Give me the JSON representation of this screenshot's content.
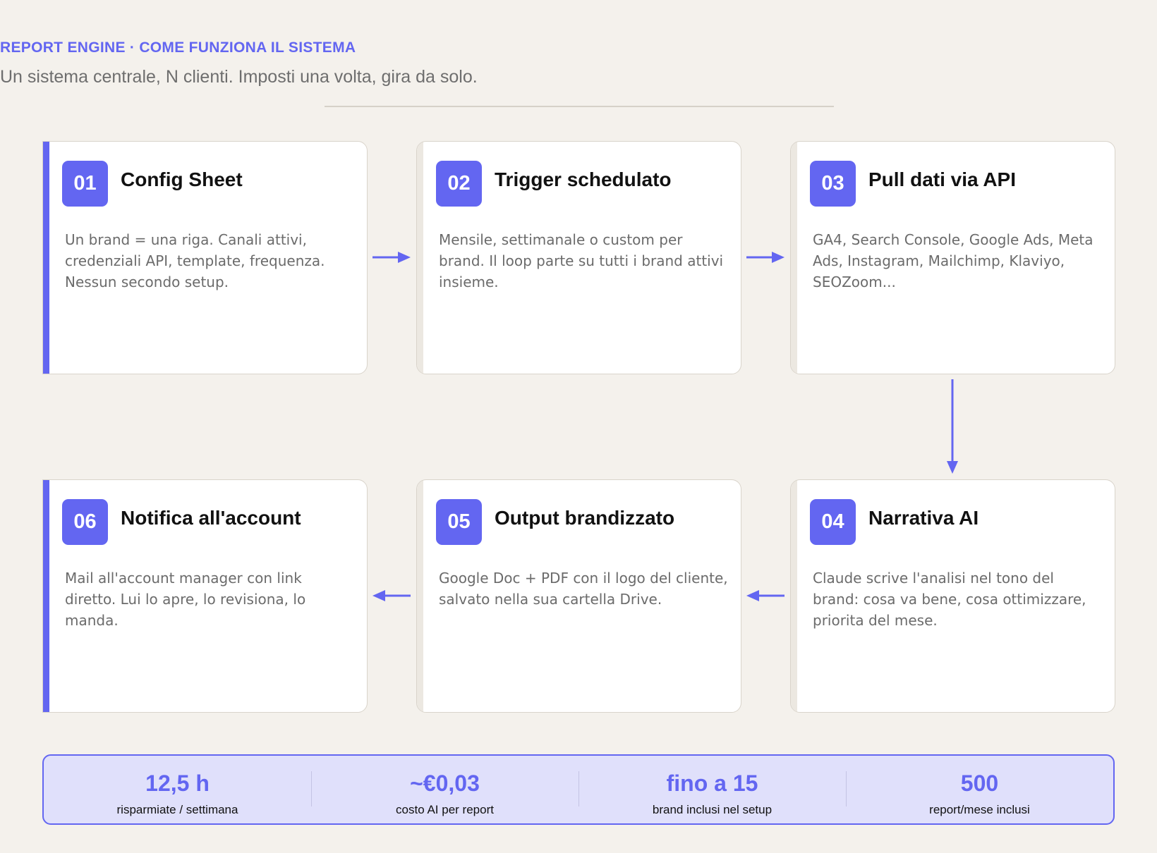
{
  "header": {
    "eyebrow": "REPORT ENGINE · COME FUNZIONA IL SISTEMA",
    "subtitle": "Un sistema centrale, N clienti. Imposti una volta, gira da solo."
  },
  "steps": [
    {
      "number": "01",
      "title": "Config Sheet",
      "description": "Un brand = una riga. Canali attivi, credenziali API, template, frequenza. Nessun secondo setup."
    },
    {
      "number": "02",
      "title": "Trigger schedulato",
      "description": "Mensile, settimanale o custom per brand. Il loop parte su tutti i brand attivi insieme."
    },
    {
      "number": "03",
      "title": "Pull dati via API",
      "description": "GA4, Search Console, Google Ads, Meta Ads, Instagram, Mailchimp, Klaviyo, SEOZoom..."
    },
    {
      "number": "04",
      "title": "Narrativa AI",
      "description": "Claude scrive l'analisi nel tono del brand: cosa va bene, cosa ottimizzare, priorita del mese."
    },
    {
      "number": "05",
      "title": "Output brandizzato",
      "description": "Google Doc + PDF con il logo del cliente, salvato nella sua cartella Drive."
    },
    {
      "number": "06",
      "title": "Notifica all'account",
      "description": "Mail all'account manager con link diretto. Lui lo apre, lo revisiona, lo manda."
    }
  ],
  "stats": [
    {
      "value": "12,5 h",
      "label": "risparmiate / settimana"
    },
    {
      "value": "~€0,03",
      "label": "costo AI per report"
    },
    {
      "value": "fino a 15",
      "label": "brand inclusi nel setup"
    },
    {
      "value": "500",
      "label": "report/mese inclusi"
    }
  ],
  "colors": {
    "accent": "#6366f1",
    "background": "#f4f1ec",
    "stats_background": "#e0e0fb"
  },
  "icons": {
    "flow_arrow": "arrow-icon"
  }
}
